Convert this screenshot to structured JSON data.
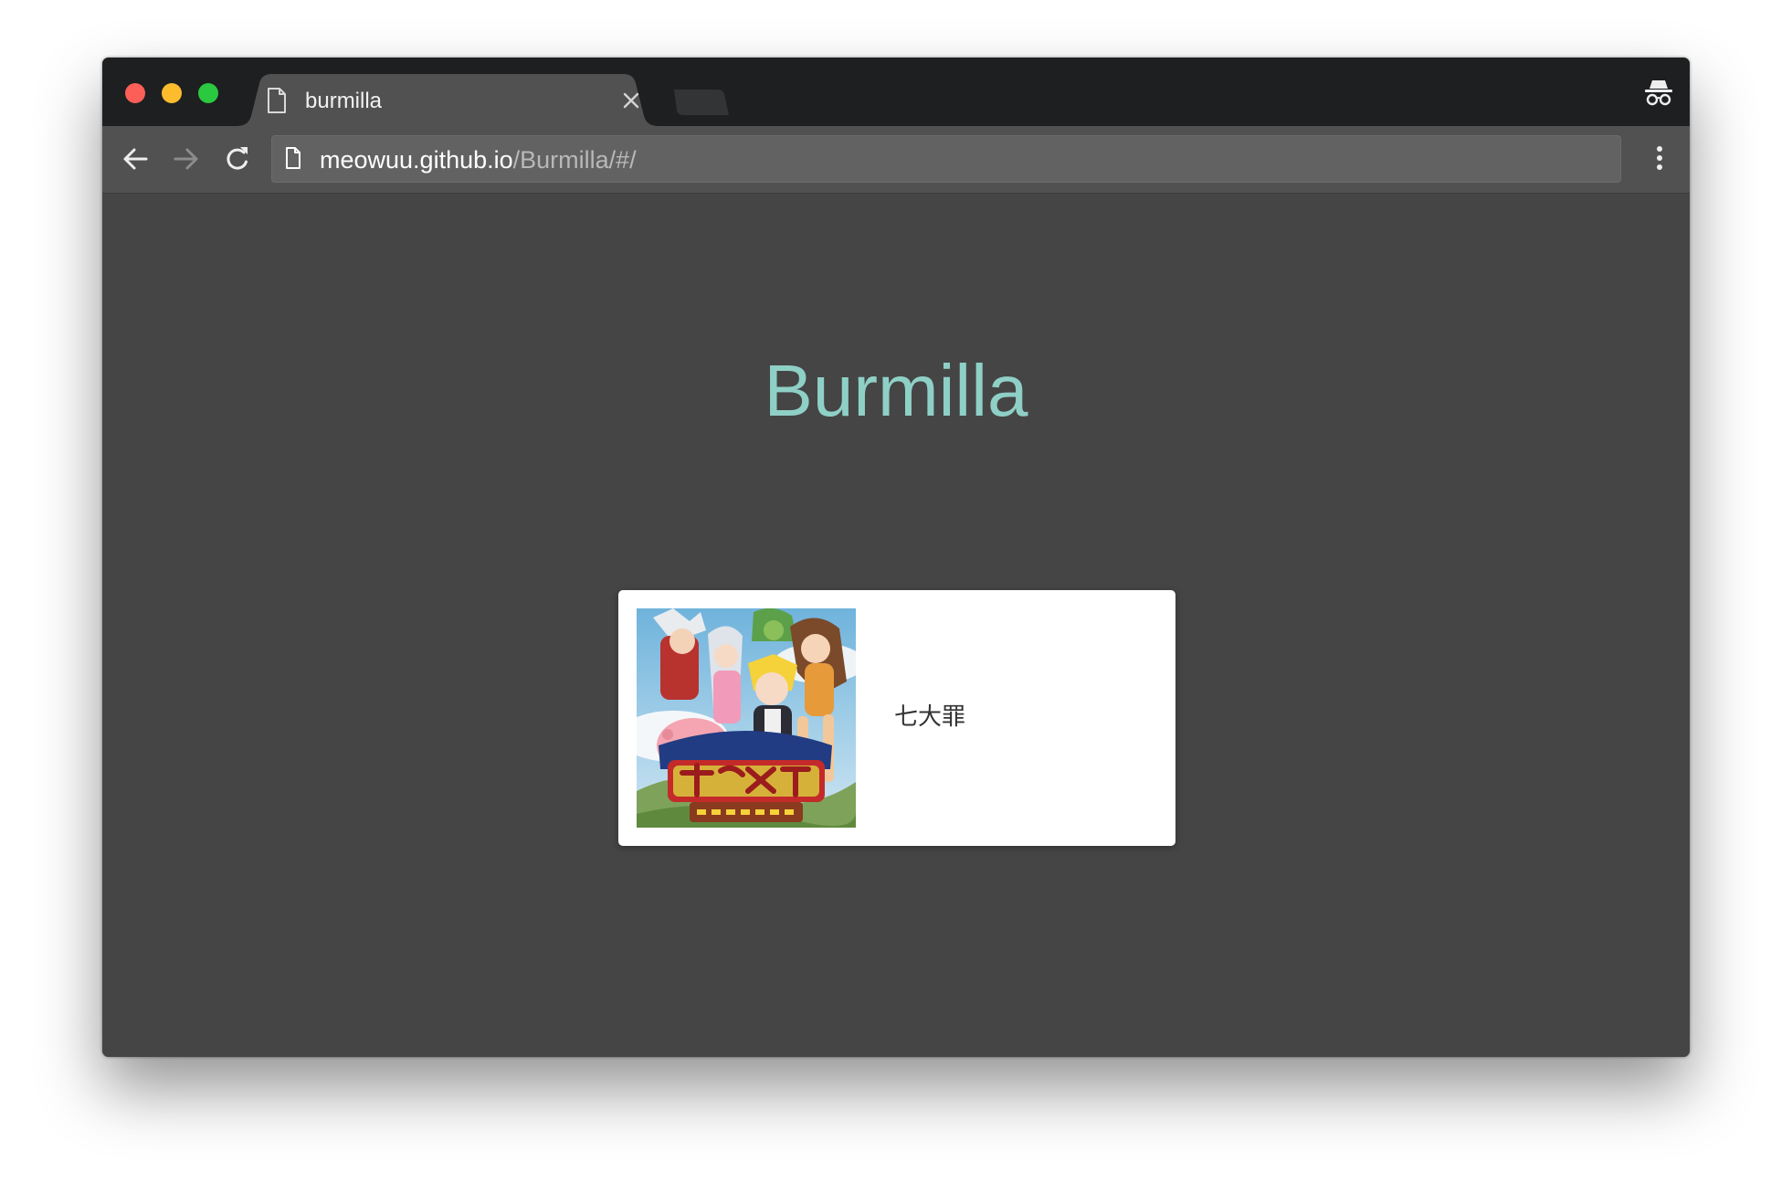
{
  "browser": {
    "tab": {
      "title": "burmilla"
    },
    "address_bar": {
      "host": "meowuu.github.io",
      "path": "/Burmilla/#/"
    },
    "icons": {
      "tab_page": "page-icon",
      "tab_close": "close-icon",
      "back": "arrow-left-icon",
      "forward": "arrow-right-icon",
      "reload": "reload-icon",
      "url_page": "page-icon",
      "menu": "vertical-dots-icon",
      "incognito": "incognito-icon"
    }
  },
  "page": {
    "title": "Burmilla",
    "cards": [
      {
        "title": "七大罪",
        "image": "anime cover art"
      }
    ]
  },
  "colors": {
    "title_accent": "#8fd0c6",
    "page_background": "#454545",
    "titlebar": "#1e1f21",
    "toolbar": "#515151"
  }
}
